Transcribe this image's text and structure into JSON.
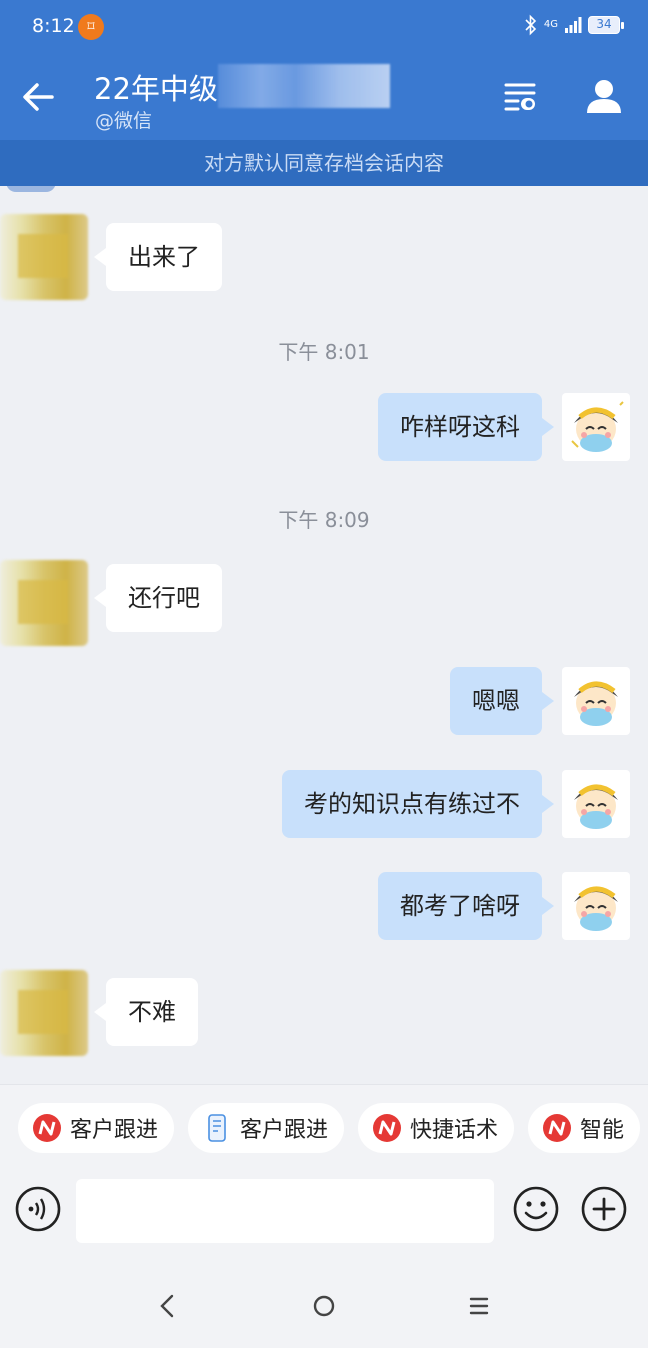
{
  "status": {
    "time": "8:12",
    "notification_glyph": "⌑",
    "network": "4G",
    "battery": "34"
  },
  "header": {
    "title": "22年中级",
    "subtitle": "@微信"
  },
  "notice": "对方默认同意存档会话内容",
  "messages": [
    {
      "side": "left",
      "text": "出来了"
    },
    {
      "side": "time",
      "text": "下午 8:01"
    },
    {
      "side": "right",
      "text": "咋样呀这科"
    },
    {
      "side": "time",
      "text": "下午 8:09"
    },
    {
      "side": "left",
      "text": "还行吧"
    },
    {
      "side": "right",
      "text": "嗯嗯"
    },
    {
      "side": "right",
      "text": "考的知识点有练过不"
    },
    {
      "side": "right",
      "text": "都考了啥呀"
    },
    {
      "side": "left",
      "text": "不难"
    }
  ],
  "chips": [
    {
      "label": "客户跟进",
      "icon": "brand-logo-icon"
    },
    {
      "label": "客户跟进",
      "icon": "phone-doc-icon"
    },
    {
      "label": "快捷话术",
      "icon": "brand-logo-icon"
    },
    {
      "label": "智能",
      "icon": "brand-logo-icon"
    }
  ],
  "input": {
    "value": "",
    "placeholder": ""
  },
  "colors": {
    "primary": "#3a79d0",
    "notice_bg": "#2f6cbf",
    "bubble_right": "#c8e0fb",
    "chat_bg": "#eef0f4"
  }
}
